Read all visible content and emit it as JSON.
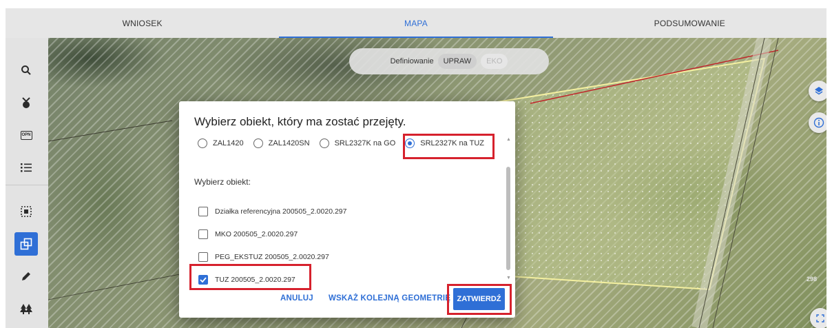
{
  "tabs": [
    "WNIOSEK",
    "MAPA",
    "PODSUMOWANIE"
  ],
  "active_tab": "MAPA",
  "mode": {
    "label": "Definiowanie",
    "options": [
      "UPRAW",
      "EKO"
    ]
  },
  "dialog": {
    "title": "Wybierz obiekt, który ma zostać przejęty.",
    "radios": [
      "ZAL1420",
      "ZAL1420SN",
      "SRL2327K na GO",
      "SRL2327K na TUZ"
    ],
    "selected_radio": "SRL2327K na TUZ",
    "subtitle": "Wybierz obiekt:",
    "items": [
      "Działka referencyjna 200505_2.0020.297",
      "MKO 200505_2.0020.297",
      "PEG_EKSTUZ 200505_2.0020.297",
      "TUZ 200505_2.0020.297"
    ],
    "checked_item": "TUZ 200505_2.0020.297",
    "buttons": {
      "cancel": "ANULUJ",
      "next_geometry": "WSKAŻ KOLEJNĄ GEOMETRIĘ",
      "confirm": "ZATWIERDŹ"
    }
  },
  "map_label": "298",
  "colors": {
    "accent": "#2f6fd6",
    "highlight": "#d6212d",
    "parcel_outline": "#f4f0a0"
  },
  "icons": [
    "search-icon",
    "plant-icon",
    "opn-icon",
    "list-icon",
    "select-area-icon",
    "copy-geometry-icon",
    "pencil-icon",
    "trees-icon",
    "layers-icon",
    "info-icon",
    "fullscreen-icon"
  ]
}
